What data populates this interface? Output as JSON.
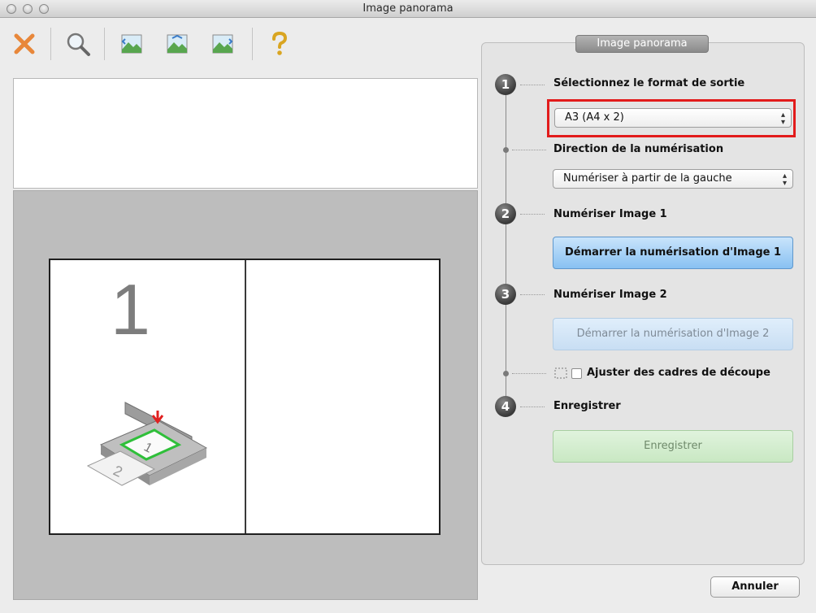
{
  "window": {
    "title": "Image panorama"
  },
  "toolbar": {
    "icons": [
      "delete-x-icon",
      "zoom-magnifier-icon",
      "image-panorama-icon-1",
      "image-panorama-icon-2",
      "image-panorama-icon-3",
      "help-question-icon"
    ]
  },
  "preview": {
    "page_number": "1"
  },
  "panel": {
    "header": "Image panorama",
    "step1_number": "1",
    "step1_label": "Sélectionnez le format de sortie",
    "output_format_value": "A3 (A4 x 2)",
    "direction_label": "Direction de la numérisation",
    "direction_value": "Numériser à partir de la gauche",
    "step2_number": "2",
    "step2_label": "Numériser Image 1",
    "scan1_button": "Démarrer la numérisation d'Image 1",
    "step3_number": "3",
    "step3_label": "Numériser Image 2",
    "scan2_button": "Démarrer la numérisation d'Image 2",
    "adjust_label": "Ajuster des cadres de découpe",
    "step4_number": "4",
    "step4_label": "Enregistrer",
    "save_button": "Enregistrer"
  },
  "footer": {
    "cancel_button": "Annuler"
  },
  "colors": {
    "highlight": "#e21b1b",
    "primary_button": "#88c1f2",
    "save_button": "#c9e8c3",
    "delete_icon": "#e8873a"
  }
}
